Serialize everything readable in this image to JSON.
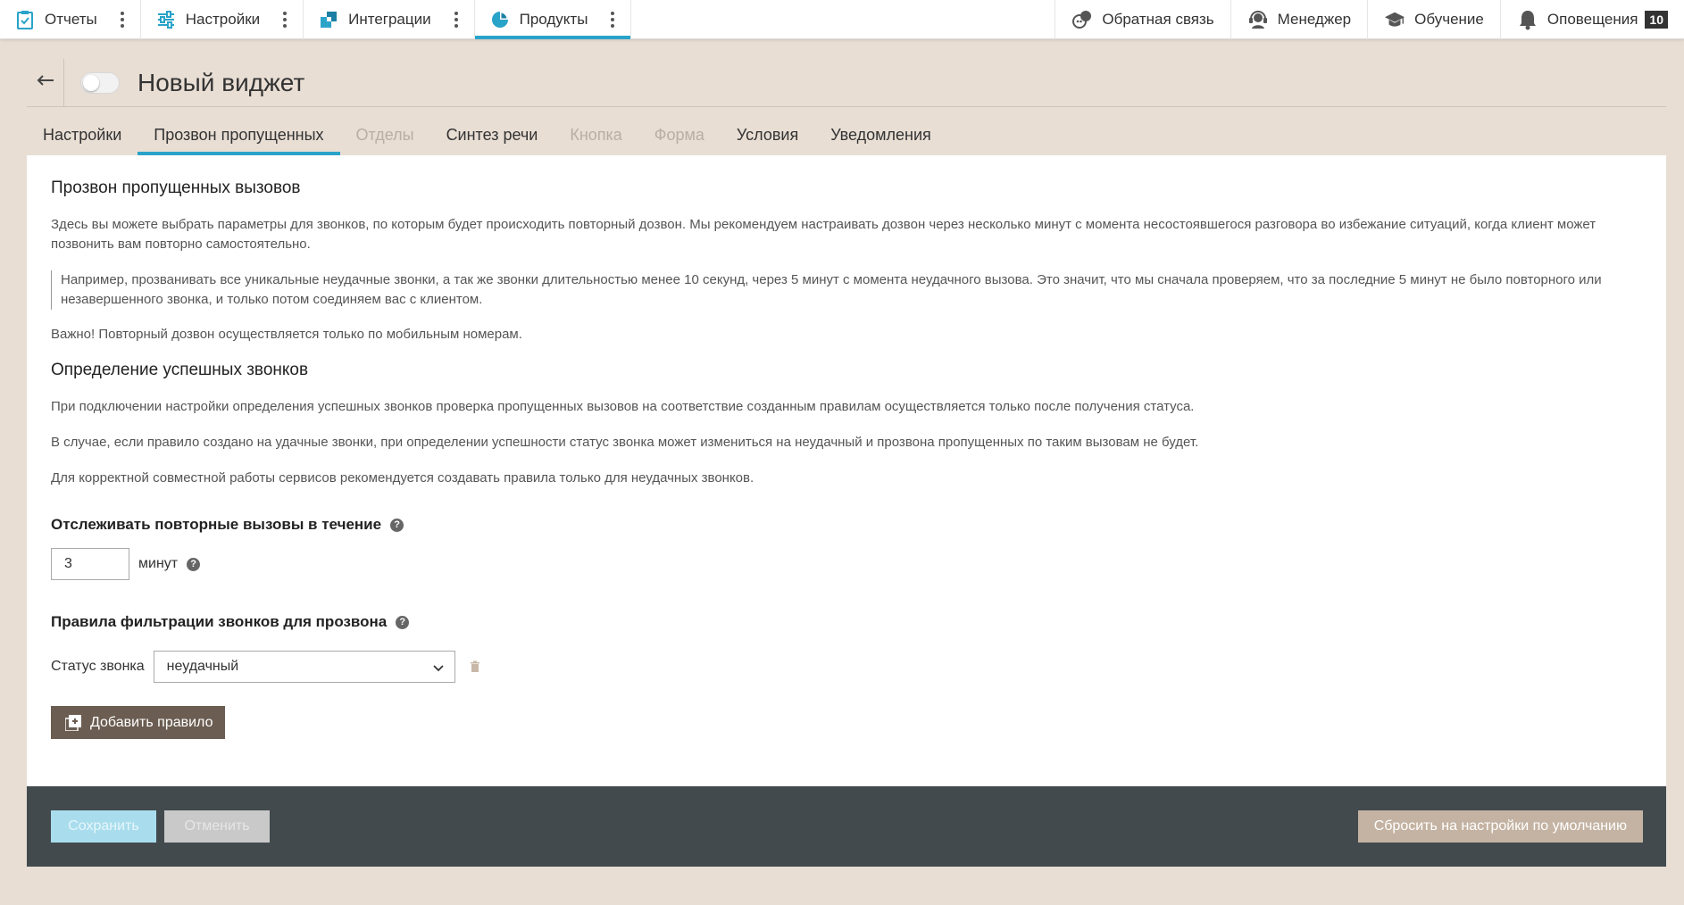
{
  "topnav": {
    "left": [
      {
        "label": "Отчеты",
        "icon": "clipboard-check-icon"
      },
      {
        "label": "Настройки",
        "icon": "sliders-icon"
      },
      {
        "label": "Интеграции",
        "icon": "puzzle-icon"
      },
      {
        "label": "Продукты",
        "icon": "pie-chart-icon",
        "active": true
      }
    ],
    "right": [
      {
        "label": "Обратная связь",
        "icon": "chat-bubbles-icon"
      },
      {
        "label": "Менеджер",
        "icon": "headset-icon"
      },
      {
        "label": "Обучение",
        "icon": "graduation-cap-icon"
      },
      {
        "label": "Оповещения",
        "icon": "bell-icon",
        "badge": "10"
      }
    ]
  },
  "header": {
    "title": "Новый виджет",
    "back_icon": "arrow-left-icon",
    "enabled": false
  },
  "tabs": [
    {
      "label": "Настройки",
      "state": "normal"
    },
    {
      "label": "Прозвон пропущенных",
      "state": "active"
    },
    {
      "label": "Отделы",
      "state": "disabled"
    },
    {
      "label": "Синтез речи",
      "state": "normal"
    },
    {
      "label": "Кнопка",
      "state": "disabled"
    },
    {
      "label": "Форма",
      "state": "disabled"
    },
    {
      "label": "Условия",
      "state": "normal"
    },
    {
      "label": "Уведомления",
      "state": "normal"
    }
  ],
  "content": {
    "section1_title": "Прозвон пропущенных вызовов",
    "section1_p1": "Здесь вы можете выбрать параметры для звонков, по которым будет происходить повторный дозвон. Мы рекомендуем настраивать дозвон через несколько минут с момента несостоявшегося разговора во избежание ситуаций, когда клиент может позвонить вам повторно самостоятельно.",
    "section1_quote": "Например, прозванивать все уникальные неудачные звонки, а так же звонки длительностью менее 10 секунд, через 5 минут с момента неудачного вызова. Это значит, что мы сначала проверяем, что за последние 5 минут не было повторного или незавершенного звонка, и только потом соединяем вас с клиентом.",
    "section1_note": "Важно! Повторный дозвон осуществляется только по мобильным номерам.",
    "section2_title": "Определение успешных звонков",
    "section2_p1": "При подключении настройки определения успешных звонков проверка пропущенных вызовов на соответствие созданным правилам осуществляется только после получения статуса.",
    "section2_p2": "В случае, если правило создано на удачные звонки, при определении успешности статус звонка может измениться на неудачный и прозвона пропущенных по таким вызовам не будет.",
    "section2_p3": "Для корректной совместной работы сервисов рекомендуется создавать правила только для неудачных звонков.",
    "track_title": "Отслеживать повторные вызовы в течение",
    "minutes_value": "3",
    "minutes_label": "минут",
    "filter_title": "Правила фильтрации звонков для прозвона",
    "status_label": "Статус звонка",
    "status_value": "неудачный",
    "add_rule_label": "Добавить правило",
    "help_glyph": "?"
  },
  "footer": {
    "save_label": "Сохранить",
    "cancel_label": "Отменить",
    "reset_label": "Сбросить на настройки по умолчанию"
  },
  "colors": {
    "accent": "#2aa3c9",
    "page_bg": "#e8ded4",
    "footer_bg": "#424a4e",
    "add_rule_bg": "#6b5d51",
    "reset_bg": "#c4b3a2",
    "save_disabled_bg": "#a9dded"
  }
}
